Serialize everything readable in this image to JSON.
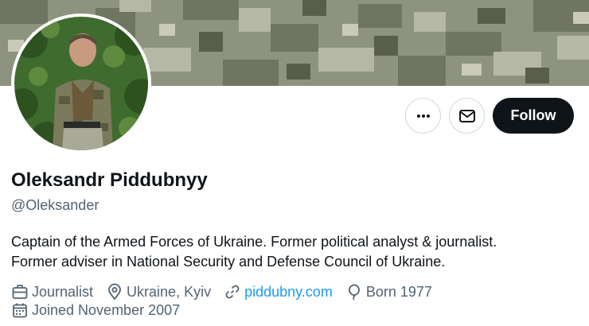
{
  "profile": {
    "name": "Oleksandr Piddubnyy",
    "handle": "@Oleksander",
    "bio_lines": [
      "Captain of the Armed Forces of Ukraine. Former political analyst & journalist.",
      "Former adviser in National Security and Defense Council of Ukraine."
    ],
    "profession": "Journalist",
    "location": "Ukraine, Kyiv",
    "website": "piddubny.com",
    "born": "Born 1977",
    "joined": "Joined November 2007"
  },
  "actions": {
    "more_icon": "more-horizontal-icon",
    "message_icon": "envelope-icon",
    "follow_label": "Follow"
  },
  "icons": {
    "profession": "briefcase-icon",
    "location": "map-pin-icon",
    "website": "link-icon",
    "born": "balloon-icon",
    "joined": "calendar-icon"
  },
  "colors": {
    "text_primary": "#0f1419",
    "text_secondary": "#536471",
    "link": "#1d9bf0",
    "follow_bg": "#0f1419",
    "border": "#cfd9de"
  }
}
